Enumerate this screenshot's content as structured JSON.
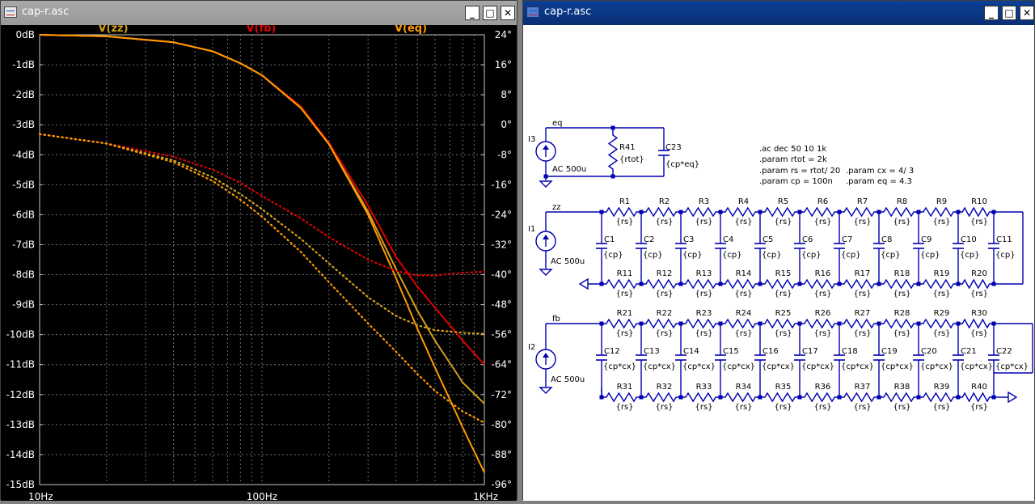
{
  "plot_window": {
    "title": "cap-r.asc",
    "buttons": {
      "minimize": "_",
      "maximize": "□",
      "close": "✕"
    },
    "trace_labels": [
      {
        "name": "V(zz)",
        "color": "#d4a017"
      },
      {
        "name": "V(fb)",
        "color": "#e00000"
      },
      {
        "name": "V(eq)",
        "color": "#ff9900"
      }
    ],
    "left_ticks": [
      "0dB",
      "-1dB",
      "-2dB",
      "-3dB",
      "-4dB",
      "-5dB",
      "-6dB",
      "-7dB",
      "-8dB",
      "-9dB",
      "-10dB",
      "-11dB",
      "-12dB",
      "-13dB",
      "-14dB",
      "-15dB"
    ],
    "right_ticks": [
      "24°",
      "16°",
      "8°",
      "0°",
      "-8°",
      "-16°",
      "-24°",
      "-32°",
      "-40°",
      "-48°",
      "-56°",
      "-64°",
      "-72°",
      "-80°",
      "-88°",
      "-96°"
    ],
    "x_ticks": [
      "10Hz",
      "100Hz",
      "1KHz"
    ]
  },
  "chart_data": {
    "type": "line",
    "x_scale": "log",
    "xlim": [
      10,
      1000
    ],
    "ylim_left_db": [
      -15,
      0
    ],
    "ylim_right_deg": [
      -96,
      24
    ],
    "grid": true,
    "series": [
      {
        "name": "V(fb)",
        "color": "#e00000",
        "axis": "magnitude_db",
        "x": [
          10,
          20,
          40,
          60,
          80,
          100,
          150,
          200,
          300,
          400,
          500,
          600,
          800,
          1000
        ],
        "y": [
          0,
          -0.05,
          -0.25,
          -0.55,
          -0.95,
          -1.35,
          -2.4,
          -3.6,
          -5.7,
          -7.4,
          -8.4,
          -9.1,
          -10.2,
          -11.0
        ]
      },
      {
        "name": "V(zz)",
        "color": "#d4a017",
        "axis": "magnitude_db",
        "x": [
          10,
          20,
          40,
          60,
          80,
          100,
          150,
          200,
          300,
          400,
          500,
          600,
          800,
          1000
        ],
        "y": [
          0,
          -0.05,
          -0.25,
          -0.55,
          -0.95,
          -1.35,
          -2.45,
          -3.65,
          -5.9,
          -7.8,
          -9.2,
          -10.2,
          -11.6,
          -12.3
        ]
      },
      {
        "name": "V(eq)",
        "color": "#ff9900",
        "axis": "magnitude_db",
        "x": [
          10,
          20,
          40,
          60,
          80,
          100,
          150,
          200,
          300,
          400,
          500,
          600,
          800,
          1000
        ],
        "y": [
          0,
          -0.05,
          -0.25,
          -0.55,
          -0.95,
          -1.35,
          -2.45,
          -3.65,
          -6.0,
          -8.1,
          -9.8,
          -11.1,
          -13.1,
          -14.6
        ]
      },
      {
        "name": "V(fb)",
        "color": "#e00000",
        "axis": "phase_deg",
        "dotted": true,
        "x": [
          10,
          20,
          40,
          60,
          80,
          100,
          150,
          200,
          300,
          400,
          500,
          600,
          800,
          1000
        ],
        "y": [
          -2.5,
          -5,
          -8.5,
          -12,
          -15.5,
          -19,
          -25,
          -30,
          -36,
          -39,
          -40.2,
          -40.2,
          -39.5,
          -39.2
        ]
      },
      {
        "name": "V(zz)",
        "color": "#d4a017",
        "axis": "phase_deg",
        "dotted": true,
        "x": [
          10,
          20,
          40,
          60,
          80,
          100,
          150,
          200,
          300,
          400,
          500,
          600,
          800,
          1000
        ],
        "y": [
          -2.5,
          -5,
          -9.5,
          -14,
          -18.5,
          -22.5,
          -30.5,
          -37,
          -46,
          -51,
          -53.5,
          -54.8,
          -55.5,
          -55.8
        ]
      },
      {
        "name": "V(eq)",
        "color": "#ff9900",
        "axis": "phase_deg",
        "dotted": true,
        "x": [
          10,
          20,
          40,
          60,
          80,
          100,
          150,
          200,
          300,
          400,
          500,
          600,
          800,
          1000
        ],
        "y": [
          -2.5,
          -5,
          -10,
          -15,
          -20,
          -24.5,
          -34,
          -42,
          -53,
          -60.5,
          -66.5,
          -71,
          -76.5,
          -79.5
        ]
      }
    ]
  },
  "schem_window": {
    "title": "cap-r.asc",
    "buttons": {
      "minimize": "_",
      "maximize": "□",
      "close": "✕"
    },
    "directives": [
      ".ac dec 50 10 1k",
      ".param rtot = 2k",
      ".param rs = rtot/ 20",
      ".param cx = 4/ 3",
      ".param cp = 100n",
      ".param eq = 4.3"
    ],
    "sources": [
      {
        "ref": "I3",
        "value": "AC 500u",
        "net": "eq"
      },
      {
        "ref": "I1",
        "value": "AC 500u",
        "net": "zz"
      },
      {
        "ref": "I2",
        "value": "AC 500u",
        "net": "fb"
      }
    ],
    "eq_parts": {
      "r_ref": "R41",
      "r_val": "{rtot}",
      "c_ref": "C23",
      "c_val": "{cp*eq}"
    },
    "ladder1": {
      "top_r": [
        "R1",
        "R2",
        "R3",
        "R4",
        "R5",
        "R6",
        "R7",
        "R8",
        "R9",
        "R10"
      ],
      "bot_r": [
        "R11",
        "R12",
        "R13",
        "R14",
        "R15",
        "R16",
        "R17",
        "R18",
        "R19",
        "R20"
      ],
      "caps": [
        "C1",
        "C2",
        "C3",
        "C4",
        "C5",
        "C6",
        "C7",
        "C8",
        "C9",
        "C10",
        "C11"
      ],
      "r_val": "{rs}",
      "c_val": "{cp}"
    },
    "ladder2": {
      "top_r": [
        "R21",
        "R22",
        "R23",
        "R24",
        "R25",
        "R26",
        "R27",
        "R28",
        "R29",
        "R30"
      ],
      "bot_r": [
        "R31",
        "R32",
        "R33",
        "R34",
        "R35",
        "R36",
        "R37",
        "R38",
        "R39",
        "R40"
      ],
      "caps": [
        "C12",
        "C13",
        "C14",
        "C15",
        "C16",
        "C17",
        "C18",
        "C19",
        "C20",
        "C21",
        "C22"
      ],
      "r_val": "{rs}",
      "c_val": "{cp*cx}"
    }
  }
}
